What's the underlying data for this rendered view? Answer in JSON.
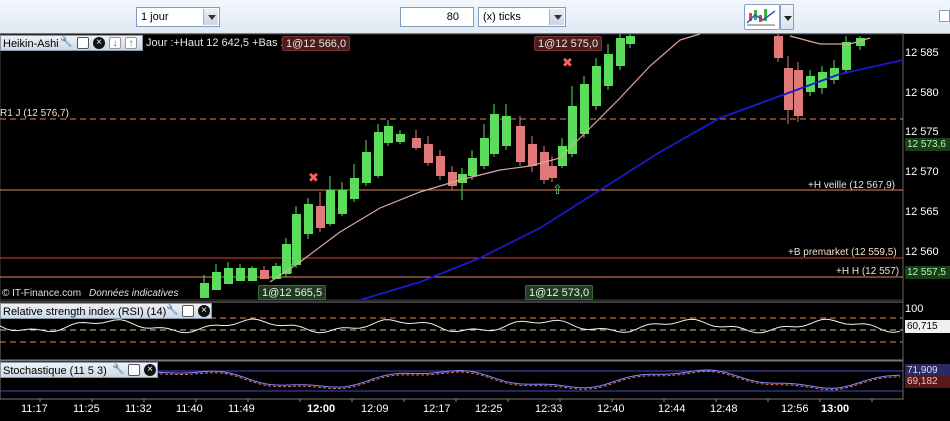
{
  "toolbar": {
    "period_value": "1 jour",
    "units_value": "80",
    "units_type": "(x) ticks"
  },
  "price_panel": {
    "title": "Heikin-Ashi",
    "header_info": "Jour :+Haut 12 642,5 +Bas 12 532,5",
    "footer_left": "© IT-Finance.com",
    "footer_right": "Données indicatives",
    "levels": [
      {
        "label": "R1 J (12 576,7)"
      },
      {
        "label": "+H veille (12 567,9)"
      },
      {
        "label": "+B premarket (12 559,5)"
      },
      {
        "label": "+H H (12 557)"
      }
    ],
    "order_tags": [
      {
        "text": "1@12 566,0",
        "kind": "sell"
      },
      {
        "text": "1@12 575,0",
        "kind": "sell"
      },
      {
        "text": "1@12 565,5",
        "kind": "buy"
      },
      {
        "text": "1@12 573,0",
        "kind": "buy"
      }
    ],
    "y_ticks": [
      "12 585",
      "12 580",
      "12 575",
      "12 570",
      "12 565",
      "12 560"
    ],
    "price_boxes": [
      "12 573,6",
      "12 557,5"
    ]
  },
  "rsi_panel": {
    "title": "Relative strength index (RSI) (14)",
    "top_value": "100",
    "current_value": "60,715"
  },
  "stoch_panel": {
    "title": "Stochastique (11 5 3)",
    "value_k": "71,909",
    "value_d": "69,182"
  },
  "time_axis": [
    "11:17",
    "11:25",
    "11:32",
    "11:40",
    "11:49",
    "12:00",
    "12:09",
    "12:17",
    "12:25",
    "12:33",
    "12:40",
    "12:44",
    "12:48",
    "12:56",
    "13:00"
  ],
  "colors": {
    "bull_candle": "#5cdc5c",
    "bear_candle": "#e07a7a",
    "ma_blue": "#1a1acc",
    "ma_pink": "#d8a8a0",
    "level_line": "#e08a5a"
  }
}
